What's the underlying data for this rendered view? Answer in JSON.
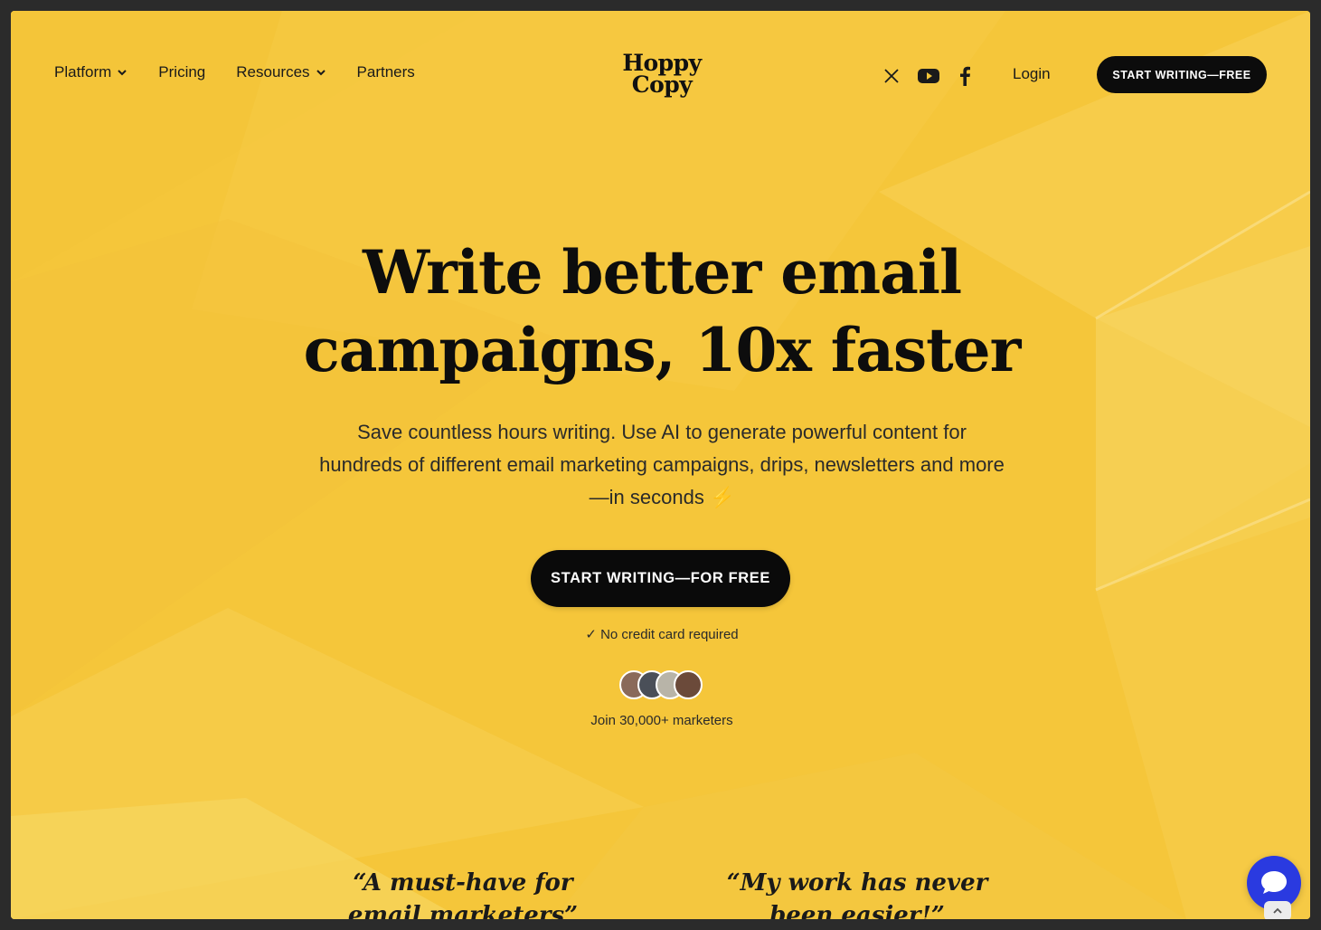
{
  "nav": {
    "items": [
      {
        "label": "Platform",
        "dropdown": true
      },
      {
        "label": "Pricing",
        "dropdown": false
      },
      {
        "label": "Resources",
        "dropdown": true
      },
      {
        "label": "Partners",
        "dropdown": false
      }
    ],
    "logo": {
      "line1": "Hoppy",
      "line2": "Copy"
    },
    "social_icons": [
      "x-icon",
      "youtube-icon",
      "facebook-icon"
    ],
    "login_label": "Login",
    "cta_label": "START WRITING—FREE"
  },
  "hero": {
    "title_line1": "Write better email",
    "title_line2": "campaigns, 10x faster",
    "subtitle": "Save countless hours writing. Use AI to generate powerful content for hundreds of different email marketing campaigns, drips, newsletters and more—in seconds",
    "bolt": "⚡",
    "cta_label": "START WRITING—FOR FREE",
    "note": "✓ No credit card required",
    "join_text": "Join 30,000+ marketers"
  },
  "quotes": [
    {
      "text": "“A must-have for email marketers”"
    },
    {
      "text": "“My work has never been easier!”"
    }
  ],
  "colors": {
    "background": "#f5c63a",
    "button": "#0a0a0a",
    "chat": "#2a3ae0"
  }
}
